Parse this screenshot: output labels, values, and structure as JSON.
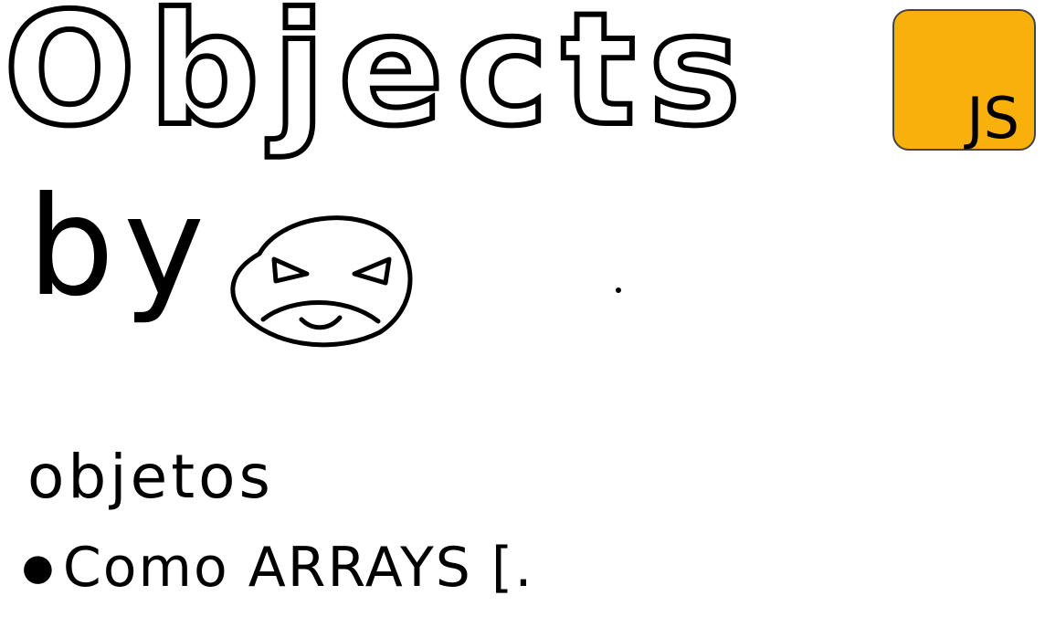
{
  "title": "Objects",
  "badge": {
    "label": "JS",
    "color": "#F8B00A"
  },
  "byline": "by",
  "notes": {
    "heading": "objetos",
    "bullet": "Como ARRAYS [."
  }
}
